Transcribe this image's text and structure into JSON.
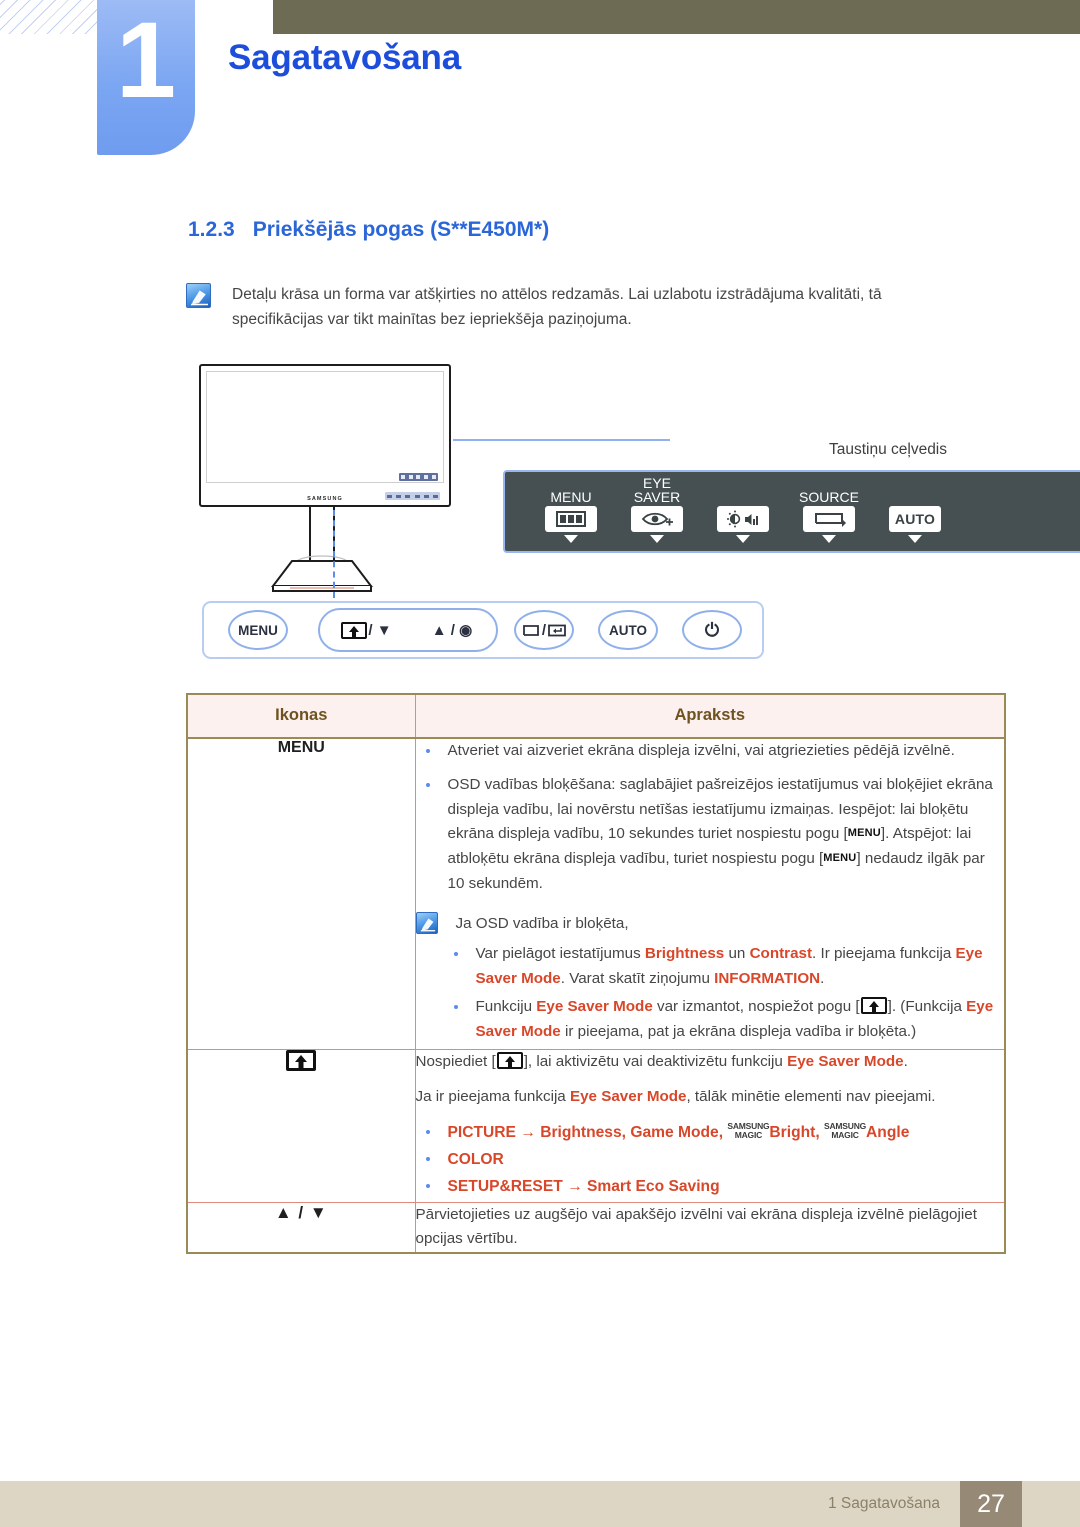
{
  "header": {
    "chapter_number": "1",
    "chapter_title": "Sagatavošana"
  },
  "section": {
    "number": "1.2.3",
    "title": "Priekšējās pogas (S**E450M*)"
  },
  "note": {
    "icon": "note-pen-icon",
    "line1": "Detaļu krāsa un forma var atšķirties no attēlos redzamās. Lai uzlabotu izstrādājuma kvalitāti, tā",
    "line2": "specifikācijas var tikt mainītas bez iepriekšēja paziņojuma."
  },
  "illustration": {
    "monitor_logo": "SAMSUNG",
    "key_guide_label": "Taustiņu ceļvedis",
    "key_guide_items": [
      {
        "caption": "MENU",
        "icon": "menu-bars-icon"
      },
      {
        "caption_line1": "EYE",
        "caption_line2": "SAVER",
        "icon": "eye-saver-icon"
      },
      {
        "caption": "",
        "icon": "brightness-volume-icon"
      },
      {
        "caption": "SOURCE",
        "icon": "source-loop-icon"
      },
      {
        "caption": "",
        "icon": "auto-icon",
        "label": "AUTO"
      }
    ],
    "buttons": [
      {
        "name": "menu-button",
        "label": "MENU"
      },
      {
        "name": "eye-saver-down-button",
        "label": "/ ▼"
      },
      {
        "name": "up-enter-button",
        "label": "▲ / ◉"
      },
      {
        "name": "source-enter-button",
        "label": "/"
      },
      {
        "name": "auto-button",
        "label": "AUTO"
      },
      {
        "name": "power-button",
        "label": "⏻"
      }
    ]
  },
  "table": {
    "headers": {
      "icons": "Ikonas",
      "description": "Apraksts"
    },
    "rows": [
      {
        "icon_label": "MENU",
        "icon_kind": "text",
        "bullets": [
          "Atveriet vai aizveriet ekrāna displeja izvēlni, vai atgriezieties pēdējā izvēlnē.",
          "OSD vadības bloķēšana: saglabājiet pašreizējos iestatījumus vai bloķējiet ekrāna displeja vadību, lai novērstu netīšas iestatījumu izmaiņas. Iespējot: lai bloķētu ekrāna displeja vadību, 10 sekundes turiet nospiestu pogu [MENU]. Atspējot: lai atbloķētu ekrāna displeja vadību, turiet nospiestu pogu [MENU] nedaudz ilgāk par 10 sekundēm."
        ],
        "inner_note": {
          "intro": "Ja OSD vadība ir bloķēta,",
          "sub_bullets": [
            "Var pielāgot iestatījumus Brightness un Contrast. Ir pieejama funkcija Eye Saver Mode. Varat skatīt ziņojumu INFORMATION.",
            "Funkciju Eye Saver Mode var izmantot, nospiežot pogu [↑]. (Funkcija Eye Saver Mode ir pieejama, pat ja ekrāna displeja vadība ir bloķēta.)"
          ]
        }
      },
      {
        "icon_label": "",
        "icon_kind": "eye-saver-icon",
        "paragraph1": "Nospiediet [↑], lai aktivizētu vai deaktivizētu funkciju Eye Saver Mode.",
        "paragraph2": "Ja ir pieejama funkcija Eye Saver Mode, tālāk minētie elementi nav pieejami.",
        "red_bullets": [
          "PICTURE → Brightness, Game Mode, SAMSUNG MAGIC Bright, SAMSUNG MAGIC Angle",
          "COLOR",
          "SETUP&RESET → Smart Eco Saving"
        ]
      },
      {
        "icon_label": "▲ / ▼",
        "icon_kind": "arrows",
        "paragraph1": "Pārvietojieties uz augšējo vai apakšējo izvēlni vai ekrāna displeja izvēlnē pielāgojiet opcijas vērtību."
      }
    ]
  },
  "footer": {
    "text": "1 Sagatavošana",
    "page": "27"
  },
  "colors": {
    "title_blue": "#1c4ddb",
    "heading_blue": "#2a66d8",
    "accent_red": "#d9472a",
    "header_bar": "#6d6b53",
    "table_border": "#9a8b56",
    "table_header_bg": "#fdf1ef",
    "footer_bg": "#ddd6c4",
    "page_badge_bg": "#968a77",
    "keyguide_bg": "#464f51"
  }
}
